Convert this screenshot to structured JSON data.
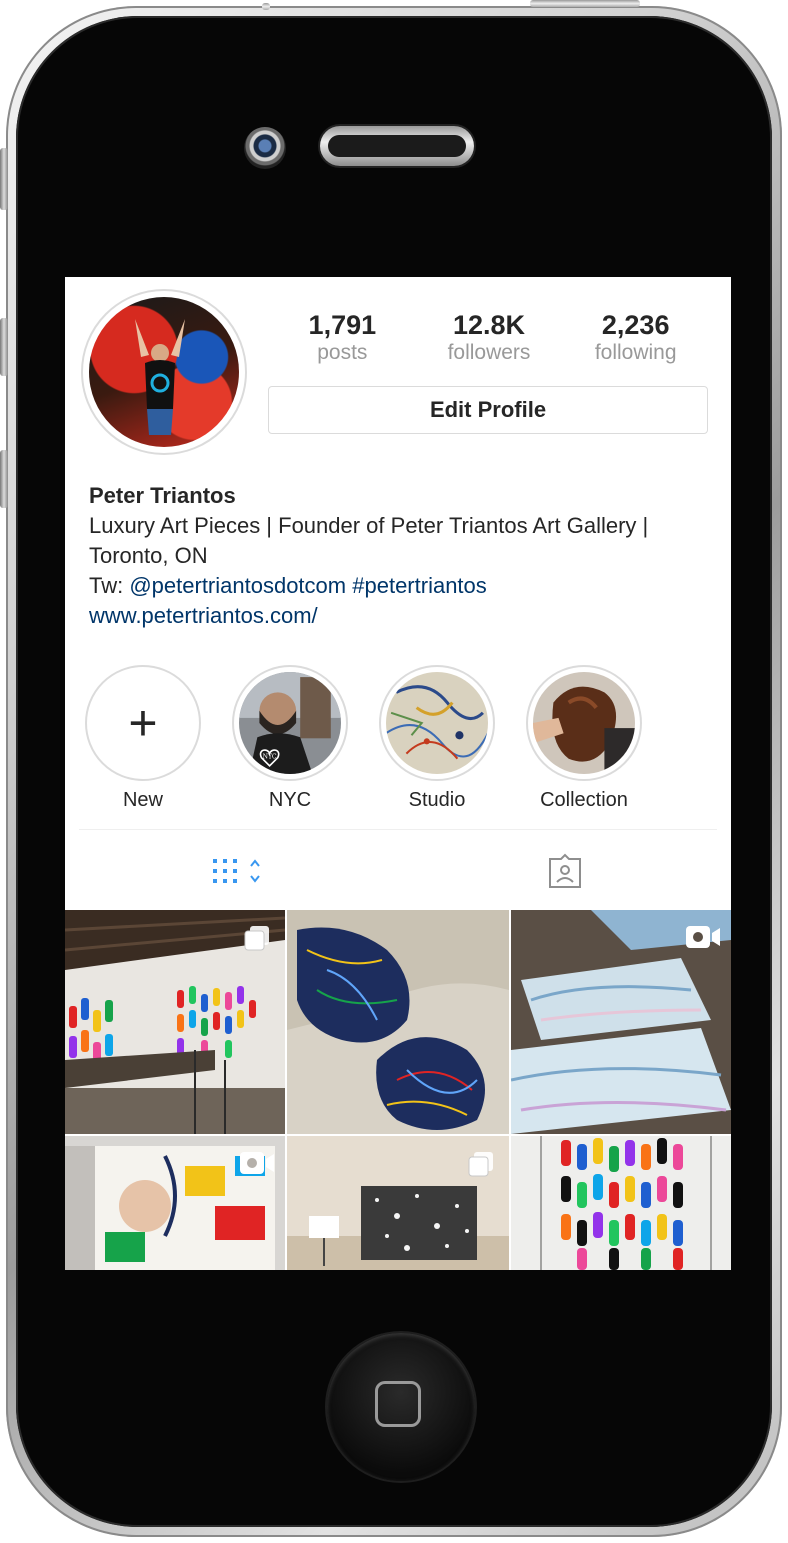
{
  "profile": {
    "stats": {
      "posts_count": "1,791",
      "posts_label": "posts",
      "followers_count": "12.8K",
      "followers_label": "followers",
      "following_count": "2,236",
      "following_label": "following"
    },
    "edit_profile_label": "Edit Profile",
    "name": "Peter Triantos",
    "bio_line": "Luxury Art Pieces | Founder of Peter Triantos Art Gallery | Toronto, ON",
    "twitter_prefix": "Tw: ",
    "twitter_handle": "@petertriantosdotcom",
    "hashtag": "#petertriantos",
    "website": "www.petertriantos.com/"
  },
  "highlights": [
    {
      "label": "New",
      "icon": "plus-icon"
    },
    {
      "label": "NYC"
    },
    {
      "label": "Studio"
    },
    {
      "label": "Collection"
    }
  ],
  "nyc_badge_text": "NYC",
  "tabs": {
    "grid_icon": "grid-view-icon",
    "tagged_icon": "tagged-photos-icon"
  },
  "posts": [
    {
      "badge": "multiple-photos-icon"
    },
    {
      "badge": ""
    },
    {
      "badge": "video-icon"
    },
    {
      "badge": "video-icon"
    },
    {
      "badge": "multiple-photos-icon"
    },
    {
      "badge": ""
    }
  ],
  "colors": {
    "accent_blue": "#3897f0",
    "link_blue": "#003569",
    "text": "#262626",
    "muted": "#999999",
    "border": "#dbdbdb"
  }
}
